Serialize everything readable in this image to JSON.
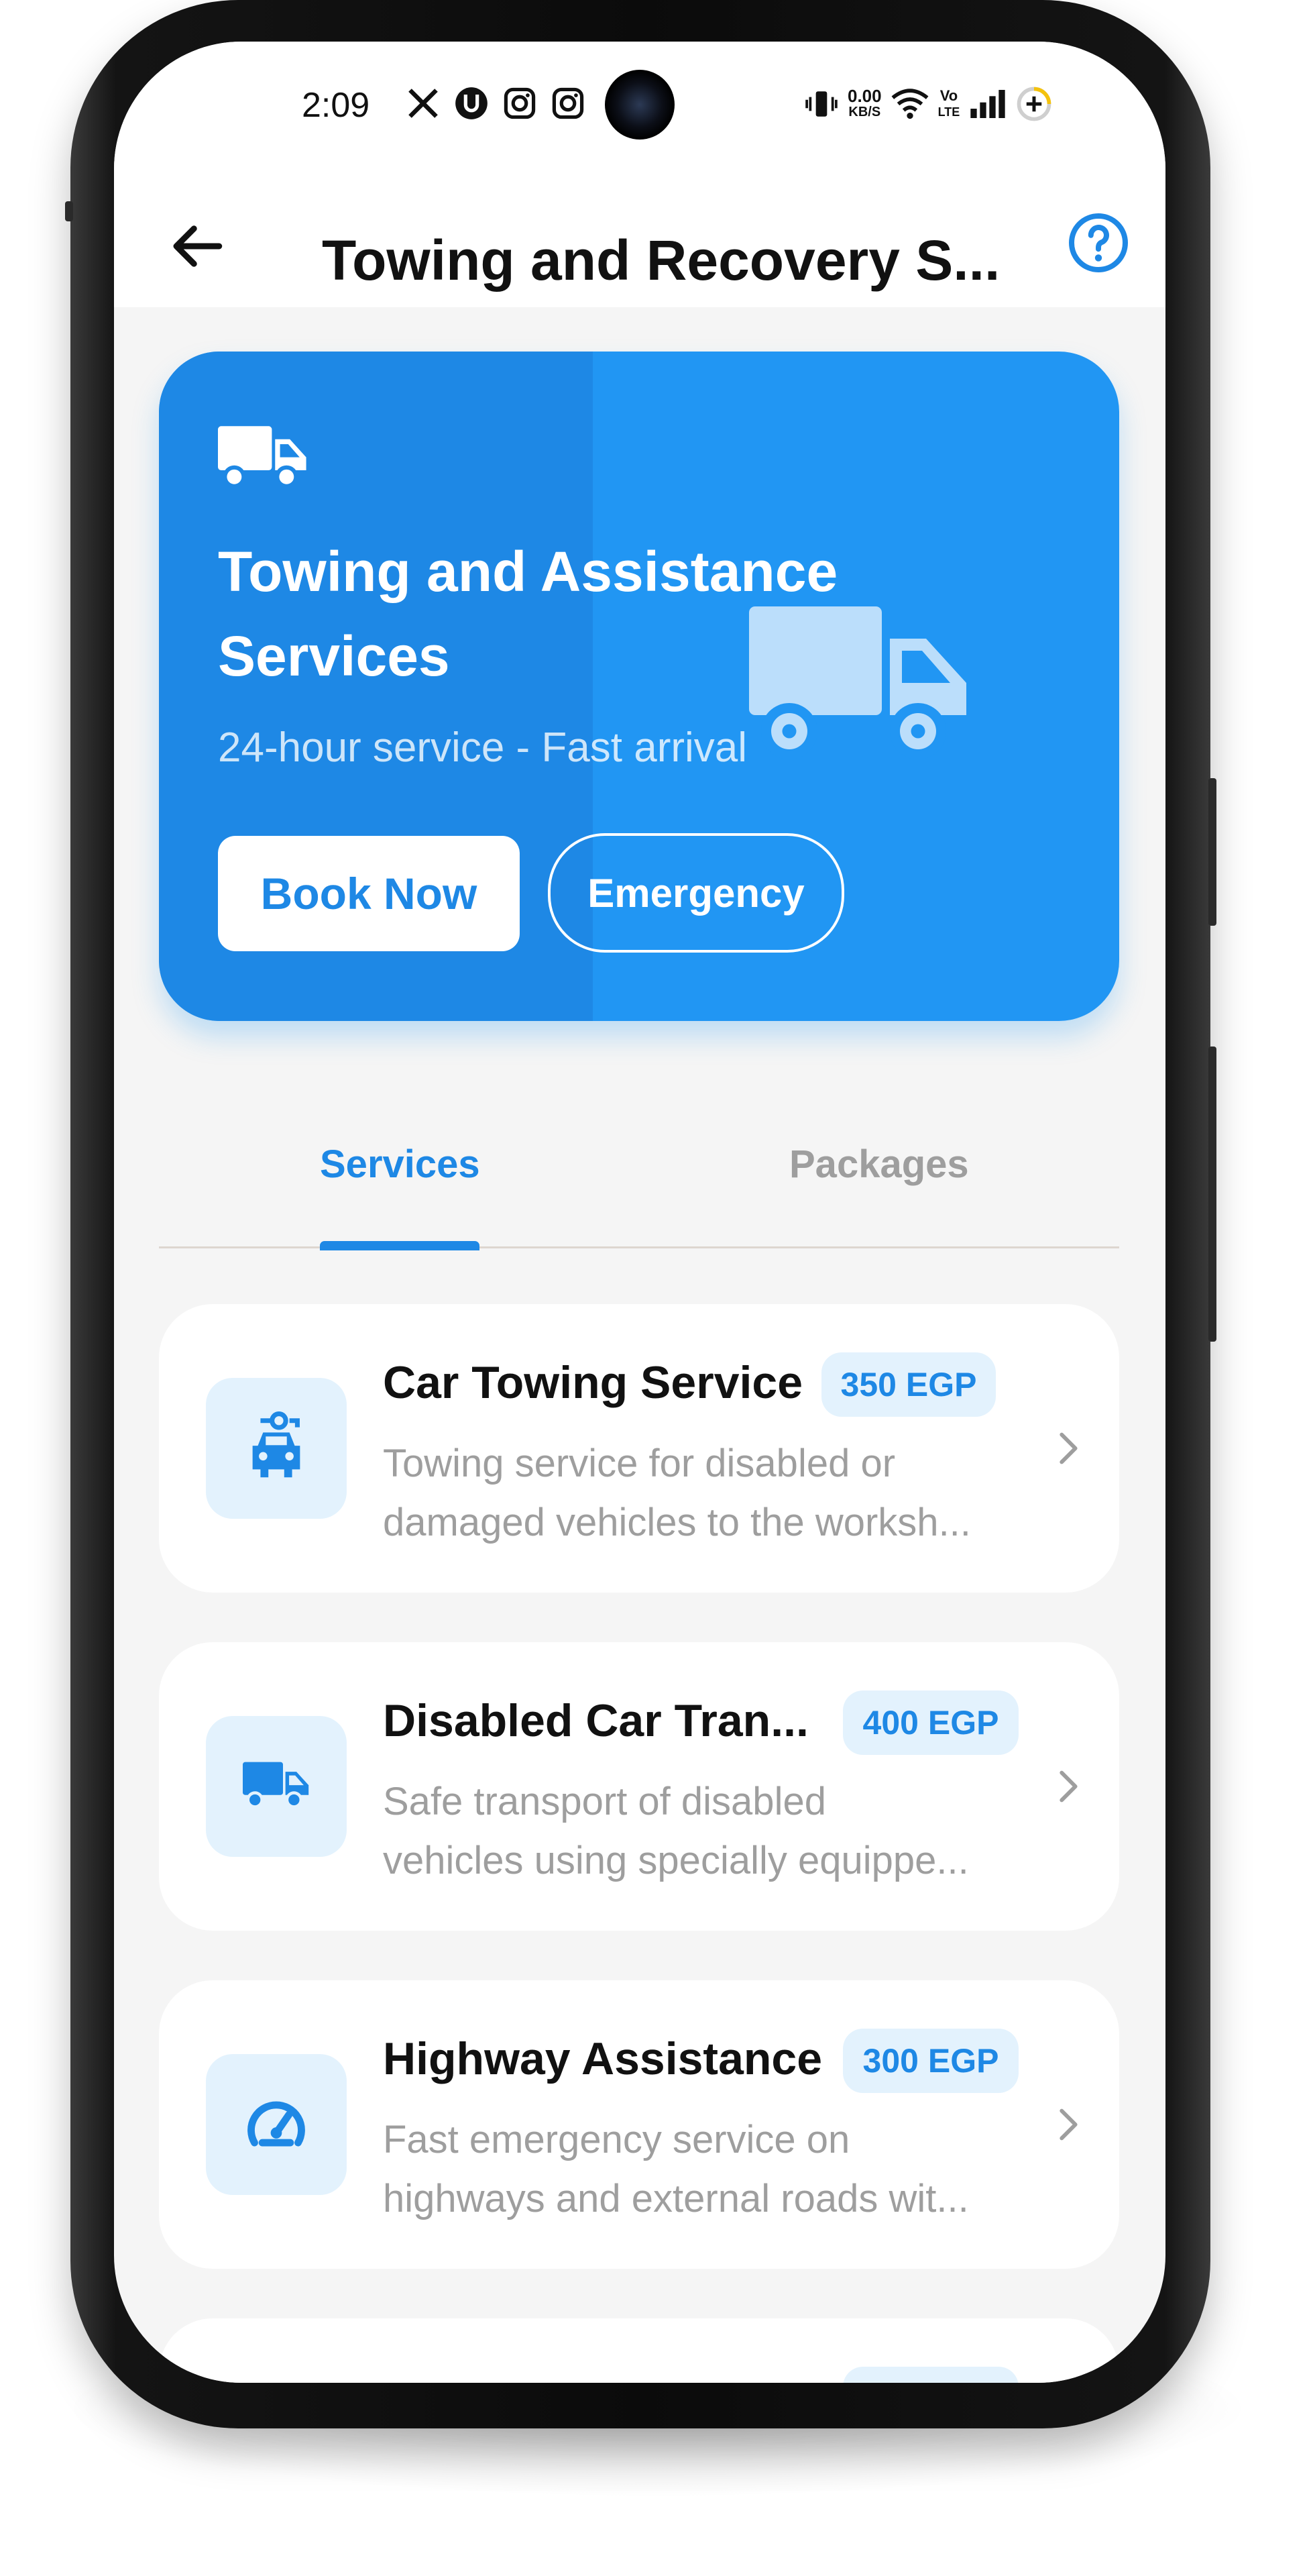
{
  "status_bar": {
    "time": "2:09",
    "net_speed_value": "0.00",
    "net_speed_unit": "KB/S",
    "volte_top": "Vo",
    "volte_bottom": "LTE"
  },
  "header": {
    "title": "Towing and Recovery S..."
  },
  "hero": {
    "title": "Towing and Assistance Services",
    "subtitle": "24-hour service - Fast arrival",
    "book_label": "Book Now",
    "emergency_label": "Emergency"
  },
  "tabs": [
    {
      "label": "Services",
      "active": true
    },
    {
      "label": "Packages",
      "active": false
    }
  ],
  "services": [
    {
      "name": "Car Towing Service",
      "price": "350 EGP",
      "desc_line1": "Towing service for disabled or",
      "desc_line2": "damaged vehicles to the worksh..."
    },
    {
      "name": "Disabled Car Tran...",
      "price": "400 EGP",
      "desc_line1": "Safe transport of disabled",
      "desc_line2": "vehicles using specially equippe..."
    },
    {
      "name": "Highway Assistance",
      "price": "300 EGP",
      "desc_line1": "Fast emergency service on",
      "desc_line2": "highways and external roads wit..."
    }
  ],
  "colors": {
    "accent": "#2196f3",
    "accent_dark": "#1e88e5",
    "icon_bg": "#e3f2fd",
    "background": "#f5f5f5"
  },
  "icons": {
    "back": "arrow-left-icon",
    "help": "help-circle-icon",
    "hero": "truck-icon",
    "service_1": "car-tow-icon",
    "service_2": "truck-icon",
    "service_3": "speedometer-icon",
    "row_action": "chevron-right-icon"
  }
}
